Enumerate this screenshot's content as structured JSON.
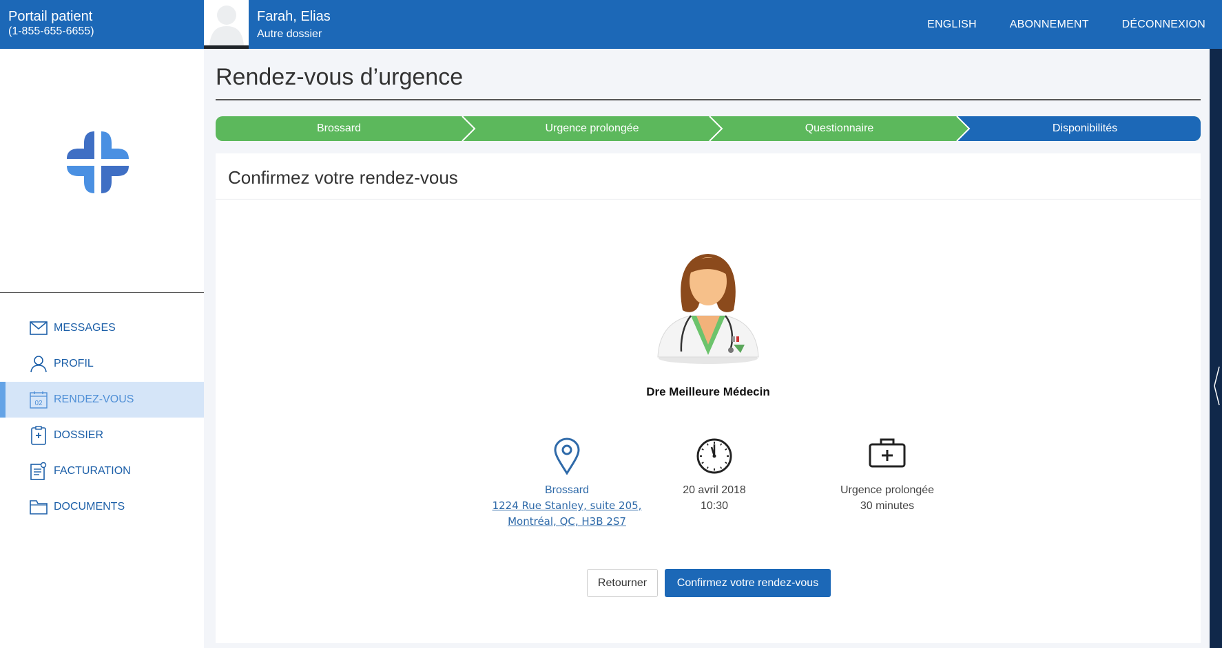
{
  "header": {
    "brand_title": "Portail patient",
    "brand_phone": "(1-855-655-6655)",
    "patient_name": "Farah, Elias",
    "patient_sub": "Autre dossier",
    "nav": [
      "ENGLISH",
      "ABONNEMENT",
      "DÉCONNEXION"
    ]
  },
  "sidebar": {
    "items": [
      {
        "label": "MESSAGES",
        "icon": "envelope-icon"
      },
      {
        "label": "PROFIL",
        "icon": "user-icon"
      },
      {
        "label": "RENDEZ-VOUS",
        "icon": "calendar-icon",
        "icon_text": "02",
        "active": true
      },
      {
        "label": "DOSSIER",
        "icon": "clipboard-icon"
      },
      {
        "label": "FACTURATION",
        "icon": "invoice-icon"
      },
      {
        "label": "DOCUMENTS",
        "icon": "folder-icon"
      }
    ]
  },
  "page": {
    "title": "Rendez-vous d’urgence",
    "steps": [
      {
        "label": "Brossard",
        "state": "done"
      },
      {
        "label": "Urgence prolongée",
        "state": "done"
      },
      {
        "label": "Questionnaire",
        "state": "done"
      },
      {
        "label": "Disponibilités",
        "state": "current"
      }
    ]
  },
  "card": {
    "title": "Confirmez votre rendez-vous",
    "doctor_name": "Dre Meilleure Médecin",
    "location": {
      "city": "Brossard",
      "address_line1": "1224 Rue Stanley, suite 205,",
      "address_line2": "Montréal, QC, H3B 2S7"
    },
    "time": {
      "date": "20 avril 2018",
      "hour": "10:30"
    },
    "type": {
      "name": "Urgence prolongée",
      "duration": "30 minutes"
    },
    "back_label": "Retourner",
    "confirm_label": "Confirmez votre rendez-vous"
  },
  "colors": {
    "primary": "#1c68b7",
    "step_done": "#5cb85c",
    "active_bg": "#d5e5f8"
  }
}
